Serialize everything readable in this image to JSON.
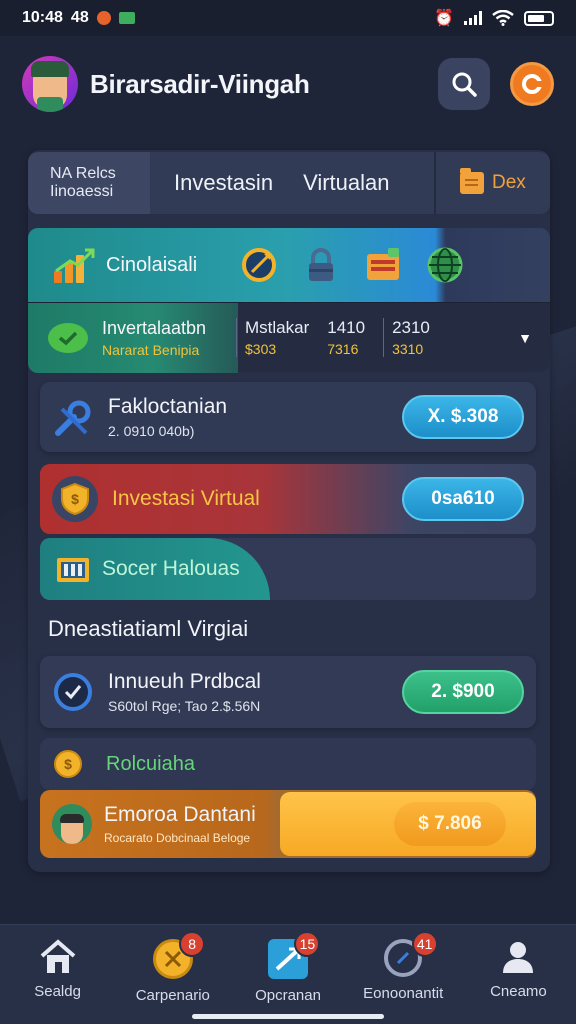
{
  "status_bar": {
    "time": "10:48",
    "extra": "48"
  },
  "header": {
    "title": "Birarsadir-Viingah"
  },
  "tabs": {
    "first_line1": "NA Relcs",
    "first_line2": "Iinoaessi",
    "middle_a": "Investasin",
    "middle_b": "Virtualan",
    "last": "Dex"
  },
  "toolbar": {
    "label": "Cinolaisali"
  },
  "info_row": {
    "title": "Invertalaatbn",
    "subtitle": "Nararat Benipia",
    "col1_head": "Mstlakar",
    "col1_val": "$303",
    "col2_head": "1410",
    "col2_val": "7316",
    "col3_head": "2310",
    "col3_val": "3310"
  },
  "cards": {
    "a_title": "Fakloctanian",
    "a_sub": "2. 0910 040b)",
    "a_button": "X. $.308",
    "b_title": "Investasi Virtual",
    "b_button": "0sa610",
    "c_title": "Socer Halouas",
    "d_title": "Innueuh Prdbcal",
    "d_sub": "S60tol Rge; Tao 2.$.56N",
    "d_button": "2. $900",
    "e_title": "Rolcuiaha",
    "f_title": "Emoroa Dantani",
    "f_sub": "Rocarato Dobcinaal Beloge",
    "f_button": "$ 7.806"
  },
  "section": {
    "title": "Dneastiatiaml Virgiai"
  },
  "nav": {
    "items": [
      {
        "label": "Sealdg",
        "badge": ""
      },
      {
        "label": "Carpenario",
        "badge": "8"
      },
      {
        "label": "Opcranan",
        "badge": "15"
      },
      {
        "label": "Eonoonantit",
        "badge": "41"
      },
      {
        "label": "Cneamo",
        "badge": ""
      }
    ]
  },
  "colors": {
    "background": "#1f2538",
    "accent_orange": "#f07a1f",
    "accent_blue": "#2b9fd8",
    "accent_green": "#2fb07a",
    "accent_red": "#b03030"
  }
}
